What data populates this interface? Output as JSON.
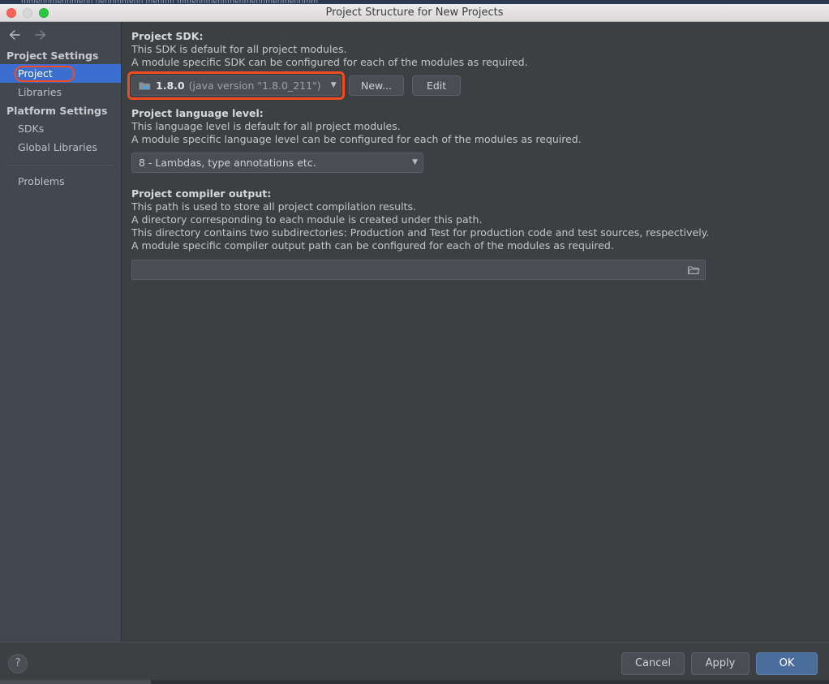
{
  "background_window": {
    "strip_text": "mmennmennmenn  nennmmenn  mennm  mmennmennmenmennmenmennmm"
  },
  "titlebar": {
    "title": "Project Structure for New Projects",
    "traffic_lights": [
      "close-red",
      "minimize-gray",
      "zoom-green"
    ]
  },
  "sidebar": {
    "back_icon": "arrow-left-icon",
    "forward_icon": "arrow-right-icon",
    "groups": [
      {
        "title": "Project Settings",
        "items": [
          {
            "label": "Project",
            "selected": true,
            "highlighted": true
          },
          {
            "label": "Libraries",
            "selected": false,
            "highlighted": false
          }
        ]
      },
      {
        "title": "Platform Settings",
        "items": [
          {
            "label": "SDKs",
            "selected": false,
            "highlighted": false
          },
          {
            "label": "Global Libraries",
            "selected": false,
            "highlighted": false
          }
        ]
      }
    ],
    "extra_items": [
      {
        "label": "Problems",
        "selected": false
      }
    ]
  },
  "content": {
    "sdk": {
      "title": "Project SDK:",
      "line1": "This SDK is default for all project modules.",
      "line2": "A module specific SDK can be configured for each of the modules as required.",
      "combo_icon": "java-sdk-icon",
      "combo_name": "1.8.0",
      "combo_version": "(java version \"1.8.0_211\")",
      "caret_icon": "chevron-down-icon",
      "new_button": "New...",
      "edit_button": "Edit",
      "highlighted": true
    },
    "language_level": {
      "title": "Project language level:",
      "line1": "This language level is default for all project modules.",
      "line2": "A module specific language level can be configured for each of the modules as required.",
      "combo_value": "8 - Lambdas, type annotations etc.",
      "caret_icon": "chevron-down-icon"
    },
    "compiler_output": {
      "title": "Project compiler output:",
      "line1": "This path is used to store all project compilation results.",
      "line2": "A directory corresponding to each module is created under this path.",
      "line3": "This directory contains two subdirectories: Production and Test for production code and test sources, respectively.",
      "line4": "A module specific compiler output path can be configured for each of the modules as required.",
      "path_value": "",
      "path_placeholder": "",
      "browse_icon": "folder-icon"
    }
  },
  "footer": {
    "help_label": "?",
    "cancel_label": "Cancel",
    "apply_label": "Apply",
    "ok_label": "OK"
  },
  "colors": {
    "accent_selection": "#3b6ecf",
    "highlight_ring": "#f44a21",
    "primary_button": "#4a6d9b",
    "sidebar_bg": "#43474f",
    "panel_bg": "#3c4043"
  }
}
